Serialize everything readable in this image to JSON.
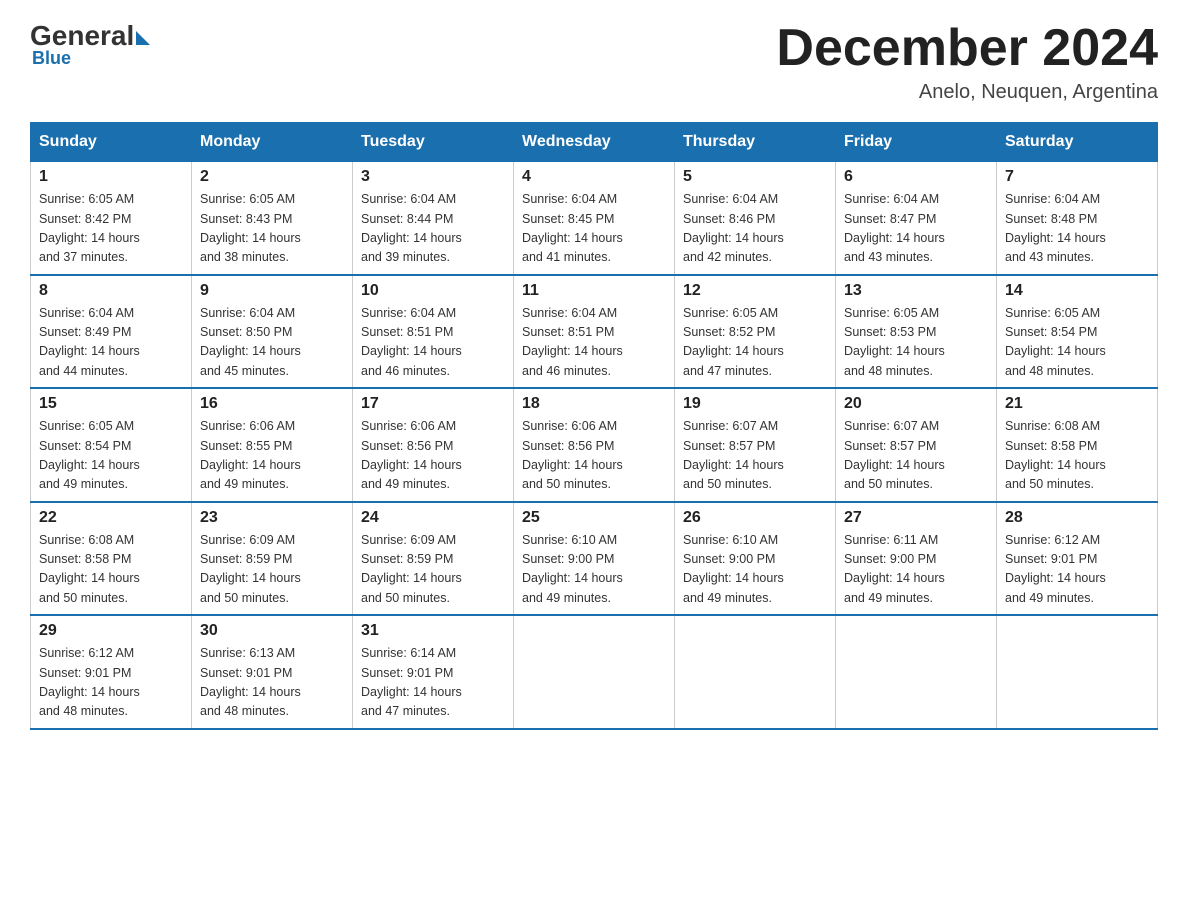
{
  "logo": {
    "general": "General",
    "blue": "Blue"
  },
  "title": "December 2024",
  "location": "Anelo, Neuquen, Argentina",
  "days_of_week": [
    "Sunday",
    "Monday",
    "Tuesday",
    "Wednesday",
    "Thursday",
    "Friday",
    "Saturday"
  ],
  "weeks": [
    [
      {
        "day": "1",
        "sunrise": "6:05 AM",
        "sunset": "8:42 PM",
        "daylight": "14 hours and 37 minutes."
      },
      {
        "day": "2",
        "sunrise": "6:05 AM",
        "sunset": "8:43 PM",
        "daylight": "14 hours and 38 minutes."
      },
      {
        "day": "3",
        "sunrise": "6:04 AM",
        "sunset": "8:44 PM",
        "daylight": "14 hours and 39 minutes."
      },
      {
        "day": "4",
        "sunrise": "6:04 AM",
        "sunset": "8:45 PM",
        "daylight": "14 hours and 41 minutes."
      },
      {
        "day": "5",
        "sunrise": "6:04 AM",
        "sunset": "8:46 PM",
        "daylight": "14 hours and 42 minutes."
      },
      {
        "day": "6",
        "sunrise": "6:04 AM",
        "sunset": "8:47 PM",
        "daylight": "14 hours and 43 minutes."
      },
      {
        "day": "7",
        "sunrise": "6:04 AM",
        "sunset": "8:48 PM",
        "daylight": "14 hours and 43 minutes."
      }
    ],
    [
      {
        "day": "8",
        "sunrise": "6:04 AM",
        "sunset": "8:49 PM",
        "daylight": "14 hours and 44 minutes."
      },
      {
        "day": "9",
        "sunrise": "6:04 AM",
        "sunset": "8:50 PM",
        "daylight": "14 hours and 45 minutes."
      },
      {
        "day": "10",
        "sunrise": "6:04 AM",
        "sunset": "8:51 PM",
        "daylight": "14 hours and 46 minutes."
      },
      {
        "day": "11",
        "sunrise": "6:04 AM",
        "sunset": "8:51 PM",
        "daylight": "14 hours and 46 minutes."
      },
      {
        "day": "12",
        "sunrise": "6:05 AM",
        "sunset": "8:52 PM",
        "daylight": "14 hours and 47 minutes."
      },
      {
        "day": "13",
        "sunrise": "6:05 AM",
        "sunset": "8:53 PM",
        "daylight": "14 hours and 48 minutes."
      },
      {
        "day": "14",
        "sunrise": "6:05 AM",
        "sunset": "8:54 PM",
        "daylight": "14 hours and 48 minutes."
      }
    ],
    [
      {
        "day": "15",
        "sunrise": "6:05 AM",
        "sunset": "8:54 PM",
        "daylight": "14 hours and 49 minutes."
      },
      {
        "day": "16",
        "sunrise": "6:06 AM",
        "sunset": "8:55 PM",
        "daylight": "14 hours and 49 minutes."
      },
      {
        "day": "17",
        "sunrise": "6:06 AM",
        "sunset": "8:56 PM",
        "daylight": "14 hours and 49 minutes."
      },
      {
        "day": "18",
        "sunrise": "6:06 AM",
        "sunset": "8:56 PM",
        "daylight": "14 hours and 50 minutes."
      },
      {
        "day": "19",
        "sunrise": "6:07 AM",
        "sunset": "8:57 PM",
        "daylight": "14 hours and 50 minutes."
      },
      {
        "day": "20",
        "sunrise": "6:07 AM",
        "sunset": "8:57 PM",
        "daylight": "14 hours and 50 minutes."
      },
      {
        "day": "21",
        "sunrise": "6:08 AM",
        "sunset": "8:58 PM",
        "daylight": "14 hours and 50 minutes."
      }
    ],
    [
      {
        "day": "22",
        "sunrise": "6:08 AM",
        "sunset": "8:58 PM",
        "daylight": "14 hours and 50 minutes."
      },
      {
        "day": "23",
        "sunrise": "6:09 AM",
        "sunset": "8:59 PM",
        "daylight": "14 hours and 50 minutes."
      },
      {
        "day": "24",
        "sunrise": "6:09 AM",
        "sunset": "8:59 PM",
        "daylight": "14 hours and 50 minutes."
      },
      {
        "day": "25",
        "sunrise": "6:10 AM",
        "sunset": "9:00 PM",
        "daylight": "14 hours and 49 minutes."
      },
      {
        "day": "26",
        "sunrise": "6:10 AM",
        "sunset": "9:00 PM",
        "daylight": "14 hours and 49 minutes."
      },
      {
        "day": "27",
        "sunrise": "6:11 AM",
        "sunset": "9:00 PM",
        "daylight": "14 hours and 49 minutes."
      },
      {
        "day": "28",
        "sunrise": "6:12 AM",
        "sunset": "9:01 PM",
        "daylight": "14 hours and 49 minutes."
      }
    ],
    [
      {
        "day": "29",
        "sunrise": "6:12 AM",
        "sunset": "9:01 PM",
        "daylight": "14 hours and 48 minutes."
      },
      {
        "day": "30",
        "sunrise": "6:13 AM",
        "sunset": "9:01 PM",
        "daylight": "14 hours and 48 minutes."
      },
      {
        "day": "31",
        "sunrise": "6:14 AM",
        "sunset": "9:01 PM",
        "daylight": "14 hours and 47 minutes."
      },
      null,
      null,
      null,
      null
    ]
  ],
  "labels": {
    "sunrise": "Sunrise:",
    "sunset": "Sunset:",
    "daylight": "Daylight:"
  }
}
